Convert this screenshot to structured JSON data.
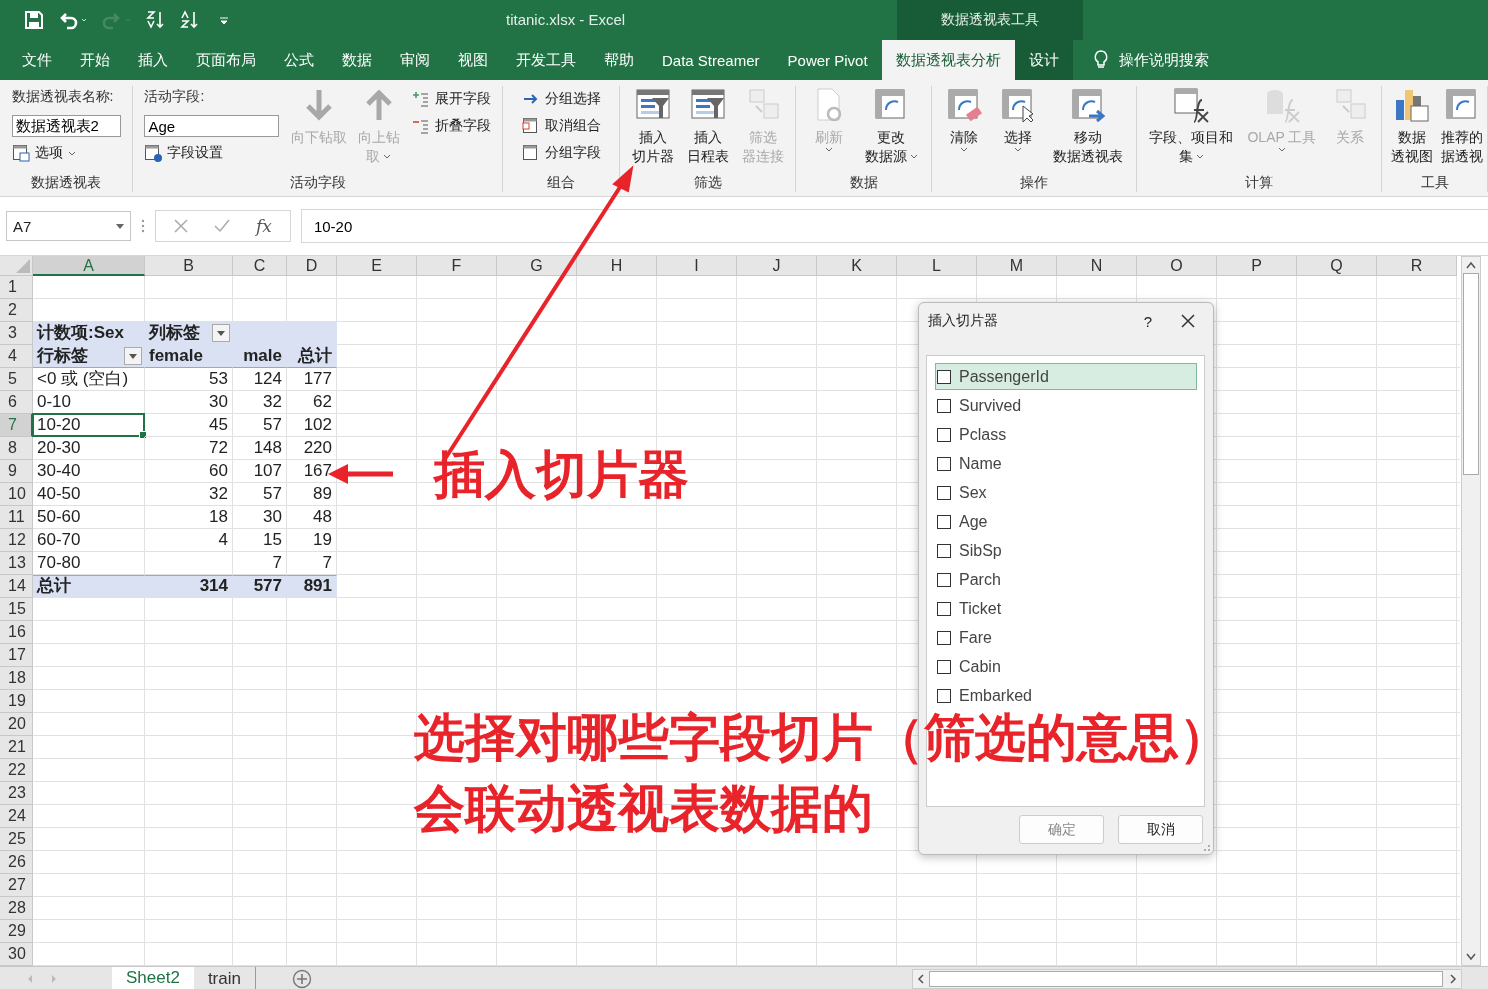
{
  "window": {
    "title": "titanic.xlsx  -  Excel",
    "context_title": "数据透视表工具"
  },
  "quick_access": [
    {
      "kind": "save",
      "disabled": false
    },
    {
      "kind": "undo",
      "disabled": false
    },
    {
      "kind": "redo",
      "disabled": true
    },
    {
      "kind": "sort_desc",
      "disabled": false
    },
    {
      "kind": "sort_asc",
      "disabled": false
    },
    {
      "kind": "customize",
      "disabled": false
    }
  ],
  "menu_tabs": [
    {
      "label": "文件",
      "selected": false,
      "context": false
    },
    {
      "label": "开始",
      "selected": false,
      "context": false
    },
    {
      "label": "插入",
      "selected": false,
      "context": false
    },
    {
      "label": "页面布局",
      "selected": false,
      "context": false
    },
    {
      "label": "公式",
      "selected": false,
      "context": false
    },
    {
      "label": "数据",
      "selected": false,
      "context": false
    },
    {
      "label": "审阅",
      "selected": false,
      "context": false
    },
    {
      "label": "视图",
      "selected": false,
      "context": false
    },
    {
      "label": "开发工具",
      "selected": false,
      "context": false
    },
    {
      "label": "帮助",
      "selected": false,
      "context": false
    },
    {
      "label": "Data Streamer",
      "selected": false,
      "context": false
    },
    {
      "label": "Power Pivot",
      "selected": false,
      "context": false
    },
    {
      "label": "数据透视表分析",
      "selected": true,
      "context": true
    },
    {
      "label": "设计",
      "selected": false,
      "context": true
    }
  ],
  "tell_me": "操作说明搜索",
  "ribbon": [
    {
      "label": "数据透视表",
      "columns": [
        [
          {
            "kind": "field",
            "label": "数据透视表名称:",
            "value": "数据透视表2"
          },
          {
            "kind": "small",
            "label": "选项",
            "dropdown": true,
            "disabled": false
          }
        ]
      ]
    },
    {
      "label": "活动字段",
      "columns": [
        [
          {
            "kind": "field",
            "label": "活动字段:",
            "value": "Age"
          },
          {
            "kind": "small",
            "label": "字段设置",
            "dropdown": false,
            "disabled": false
          }
        ],
        [
          {
            "kind": "large",
            "lines": [
              "向下钻取"
            ],
            "dropdown": false,
            "disabled": true
          }
        ],
        [
          {
            "kind": "large",
            "lines": [
              "向上钻",
              "取"
            ],
            "dropdown": true,
            "disabled": true
          }
        ],
        [
          {
            "kind": "small",
            "label": "展开字段",
            "dropdown": false,
            "disabled": false
          },
          {
            "kind": "small",
            "label": "折叠字段",
            "dropdown": false,
            "disabled": false
          }
        ]
      ]
    },
    {
      "label": "组合",
      "columns": [
        [
          {
            "kind": "small",
            "label": "分组选择",
            "dropdown": false,
            "disabled": false
          },
          {
            "kind": "small",
            "label": "取消组合",
            "dropdown": false,
            "disabled": false
          },
          {
            "kind": "small",
            "label": "分组字段",
            "dropdown": false,
            "disabled": false
          }
        ]
      ]
    },
    {
      "label": "筛选",
      "columns": [
        [
          {
            "kind": "large",
            "lines": [
              "插入",
              "切片器"
            ],
            "dropdown": false,
            "disabled": false
          }
        ],
        [
          {
            "kind": "large",
            "lines": [
              "插入",
              "日程表"
            ],
            "dropdown": false,
            "disabled": false
          }
        ],
        [
          {
            "kind": "large",
            "lines": [
              "筛选",
              "器连接"
            ],
            "dropdown": false,
            "disabled": true
          }
        ]
      ]
    },
    {
      "label": "数据",
      "columns": [
        [
          {
            "kind": "large",
            "lines": [
              "刷新"
            ],
            "dropdown": true,
            "disabled": true
          }
        ],
        [
          {
            "kind": "large",
            "lines": [
              "更改",
              "数据源"
            ],
            "dropdown": true,
            "disabled": false
          }
        ]
      ]
    },
    {
      "label": "操作",
      "columns": [
        [
          {
            "kind": "large",
            "lines": [
              "清除"
            ],
            "dropdown": true,
            "disabled": false
          }
        ],
        [
          {
            "kind": "large",
            "lines": [
              "选择"
            ],
            "dropdown": true,
            "disabled": false
          }
        ],
        [
          {
            "kind": "large",
            "lines": [
              "移动",
              "数据透视表"
            ],
            "dropdown": false,
            "disabled": false
          }
        ]
      ]
    },
    {
      "label": "计算",
      "columns": [
        [
          {
            "kind": "large",
            "lines": [
              "字段、项目和",
              "集"
            ],
            "dropdown": true,
            "disabled": false
          }
        ],
        [
          {
            "kind": "large",
            "lines": [
              "OLAP 工具"
            ],
            "dropdown": true,
            "disabled": true
          }
        ],
        [
          {
            "kind": "large",
            "lines": [
              "关系"
            ],
            "dropdown": false,
            "disabled": true
          }
        ]
      ]
    },
    {
      "label": "工具",
      "columns": [
        [
          {
            "kind": "large",
            "lines": [
              "数据",
              "透视图"
            ],
            "dropdown": false,
            "disabled": false
          }
        ],
        [
          {
            "kind": "large",
            "lines": [
              "推荐的",
              "据透视"
            ],
            "dropdown": false,
            "disabled": false
          }
        ]
      ]
    }
  ],
  "formula_bar": {
    "name_box": "A7",
    "function_label": "fx",
    "formula": "10-20"
  },
  "sheet": {
    "columns": [
      "A",
      "B",
      "C",
      "D",
      "E",
      "F",
      "G",
      "H",
      "I",
      "J",
      "K",
      "L",
      "M",
      "N",
      "O",
      "P",
      "Q",
      "R"
    ],
    "row_numbers": [
      "1",
      "2",
      "3",
      "4",
      "5",
      "6",
      "7",
      "8",
      "9",
      "10",
      "11",
      "12",
      "13",
      "14",
      "15",
      "16",
      "17",
      "18",
      "19",
      "20",
      "21",
      "22",
      "23",
      "24",
      "25",
      "26",
      "27",
      "28",
      "29",
      "30"
    ],
    "pivot": {
      "value_field": "计数项:Sex",
      "column_label": "列标签",
      "row_label": "行标签",
      "column_headers": [
        "female",
        "male",
        "总计"
      ],
      "rows": [
        {
          "label": "<0 或 (空白)",
          "female": "53",
          "male": "124",
          "total": "177",
          "selected": false
        },
        {
          "label": "0-10",
          "female": "30",
          "male": "32",
          "total": "62",
          "selected": false
        },
        {
          "label": "10-20",
          "female": "45",
          "male": "57",
          "total": "102",
          "selected": true
        },
        {
          "label": "20-30",
          "female": "72",
          "male": "148",
          "total": "220",
          "selected": false
        },
        {
          "label": "30-40",
          "female": "60",
          "male": "107",
          "total": "167",
          "selected": false
        },
        {
          "label": "40-50",
          "female": "32",
          "male": "57",
          "total": "89",
          "selected": false
        },
        {
          "label": "50-60",
          "female": "18",
          "male": "30",
          "total": "48",
          "selected": false
        },
        {
          "label": "60-70",
          "female": "4",
          "male": "15",
          "total": "19",
          "selected": false
        },
        {
          "label": "70-80",
          "male": "7",
          "total": "7",
          "selected": false
        }
      ],
      "total": {
        "label": "总计",
        "female": "314",
        "male": "577",
        "total": "891"
      }
    }
  },
  "sheet_tabs": [
    {
      "label": "Sheet2",
      "selected": true
    },
    {
      "label": "train",
      "selected": false
    }
  ],
  "dialog": {
    "title": "插入切片器",
    "help": "?",
    "fields": [
      {
        "label": "PassengerId",
        "checked": false,
        "selected": true
      },
      {
        "label": "Survived",
        "checked": false,
        "selected": false
      },
      {
        "label": "Pclass",
        "checked": false,
        "selected": false
      },
      {
        "label": "Name",
        "checked": false,
        "selected": false
      },
      {
        "label": "Sex",
        "checked": false,
        "selected": false
      },
      {
        "label": "Age",
        "checked": false,
        "selected": false
      },
      {
        "label": "SibSp",
        "checked": false,
        "selected": false
      },
      {
        "label": "Parch",
        "checked": false,
        "selected": false
      },
      {
        "label": "Ticket",
        "checked": false,
        "selected": false
      },
      {
        "label": "Fare",
        "checked": false,
        "selected": false
      },
      {
        "label": "Cabin",
        "checked": false,
        "selected": false
      },
      {
        "label": "Embarked",
        "checked": false,
        "selected": false
      }
    ],
    "buttons": [
      {
        "label": "确定",
        "disabled": true
      },
      {
        "label": "取消",
        "disabled": false
      }
    ]
  },
  "annotations": [
    {
      "text": "插入切片器"
    },
    {
      "text": "选择对哪些字段切片（筛选的意思）"
    },
    {
      "text": "会联动透视表数据的"
    }
  ]
}
